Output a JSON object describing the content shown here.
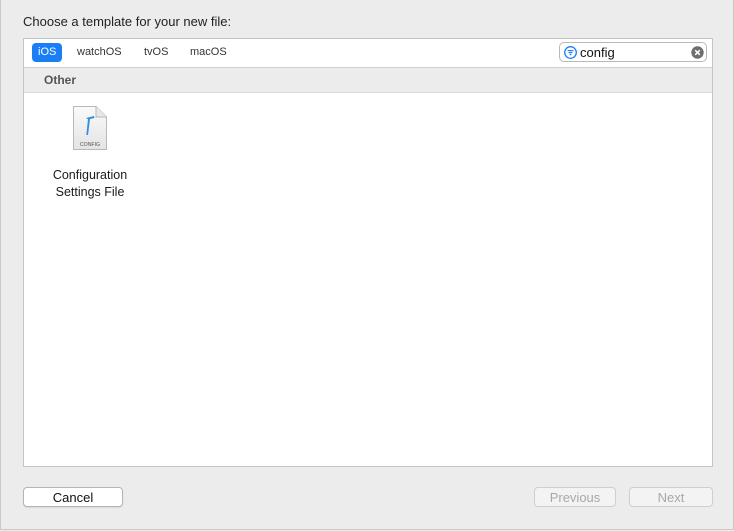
{
  "dialog": {
    "title": "Choose a template for your new file:"
  },
  "tabs": [
    {
      "label": "iOS",
      "selected": true
    },
    {
      "label": "watchOS",
      "selected": false
    },
    {
      "label": "tvOS",
      "selected": false
    },
    {
      "label": "macOS",
      "selected": false
    }
  ],
  "search": {
    "value": "config",
    "filter_icon": "filter-icon",
    "clear_icon": "clear-icon"
  },
  "section": {
    "title": "Other"
  },
  "templates": [
    {
      "icon": "config-file-icon",
      "icon_caption": "CONFIG",
      "line1": "Configuration",
      "line2": "Settings File",
      "selected": false
    }
  ],
  "buttons": {
    "cancel": "Cancel",
    "previous": "Previous",
    "next": "Next",
    "previous_enabled": false,
    "next_enabled": false
  },
  "colors": {
    "accent": "#1a7ff6",
    "background": "#ececec",
    "disabled_text": "#a8a8a8"
  }
}
